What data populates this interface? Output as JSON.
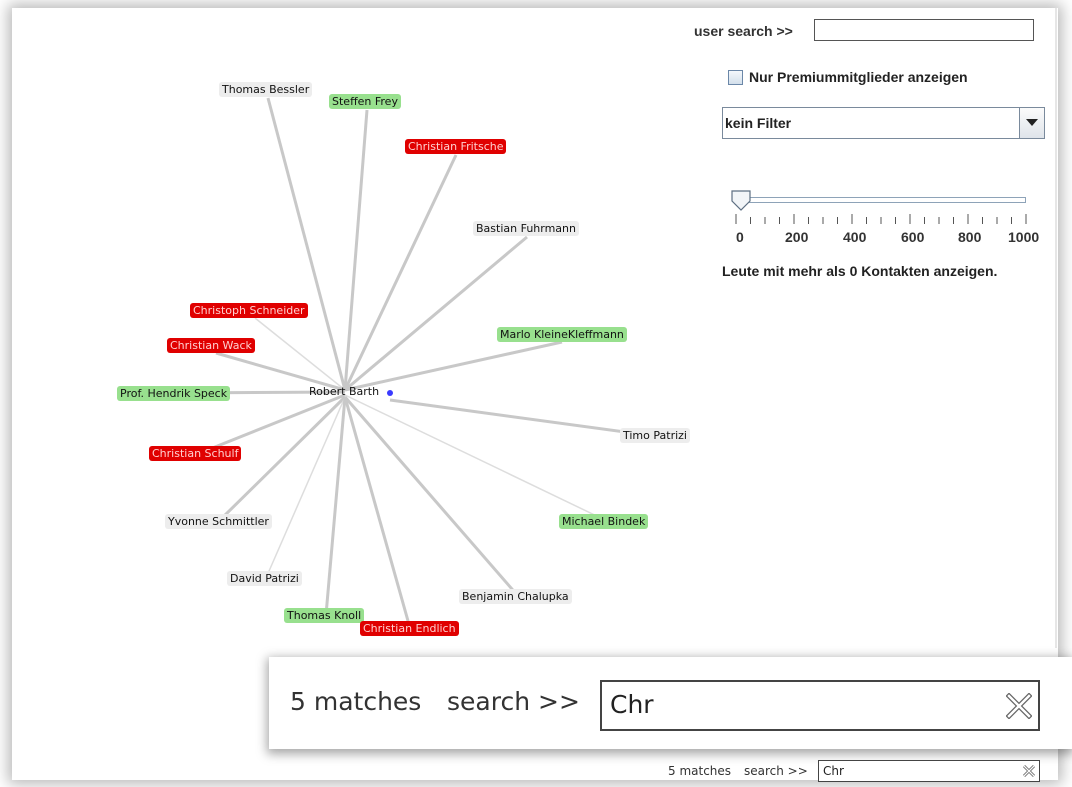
{
  "user_search": {
    "label": "user search >>",
    "value": ""
  },
  "premium_checkbox": {
    "label": "Nur Premiummitglieder anzeigen",
    "checked": false
  },
  "filter_select": {
    "value": "kein Filter"
  },
  "contacts_slider": {
    "value": 0,
    "min": 0,
    "max": 1000,
    "tick_labels": [
      "0",
      "200",
      "400",
      "600",
      "800",
      "1000"
    ],
    "caption": "Leute mit mehr als 0 Kontakten anzeigen."
  },
  "graph": {
    "center": {
      "label": "Robert Barth"
    },
    "status_colors": {
      "gray": "#ededed",
      "green": "#98e08e",
      "red": "#e00000"
    },
    "nodes": [
      {
        "label": "Thomas Bessler",
        "status": "gray"
      },
      {
        "label": "Steffen Frey",
        "status": "green"
      },
      {
        "label": "Christian Fritsche",
        "status": "red"
      },
      {
        "label": "Bastian Fuhrmann",
        "status": "gray"
      },
      {
        "label": "Christoph Schneider",
        "status": "red"
      },
      {
        "label": "Marlo KleineKleffmann",
        "status": "green"
      },
      {
        "label": "Christian Wack",
        "status": "red"
      },
      {
        "label": "Prof. Hendrik Speck",
        "status": "green"
      },
      {
        "label": "Timo Patrizi",
        "status": "gray"
      },
      {
        "label": "Christian Schulf",
        "status": "red"
      },
      {
        "label": "Michael Bindek",
        "status": "green"
      },
      {
        "label": "Yvonne Schmittler",
        "status": "gray"
      },
      {
        "label": "David Patrizi",
        "status": "gray"
      },
      {
        "label": "Benjamin Chalupka",
        "status": "gray"
      },
      {
        "label": "Thomas Knoll",
        "status": "green"
      },
      {
        "label": "Christian Endlich",
        "status": "red"
      }
    ]
  },
  "search": {
    "matches_text": "5 matches",
    "label": "search >>",
    "value": "Chr"
  }
}
